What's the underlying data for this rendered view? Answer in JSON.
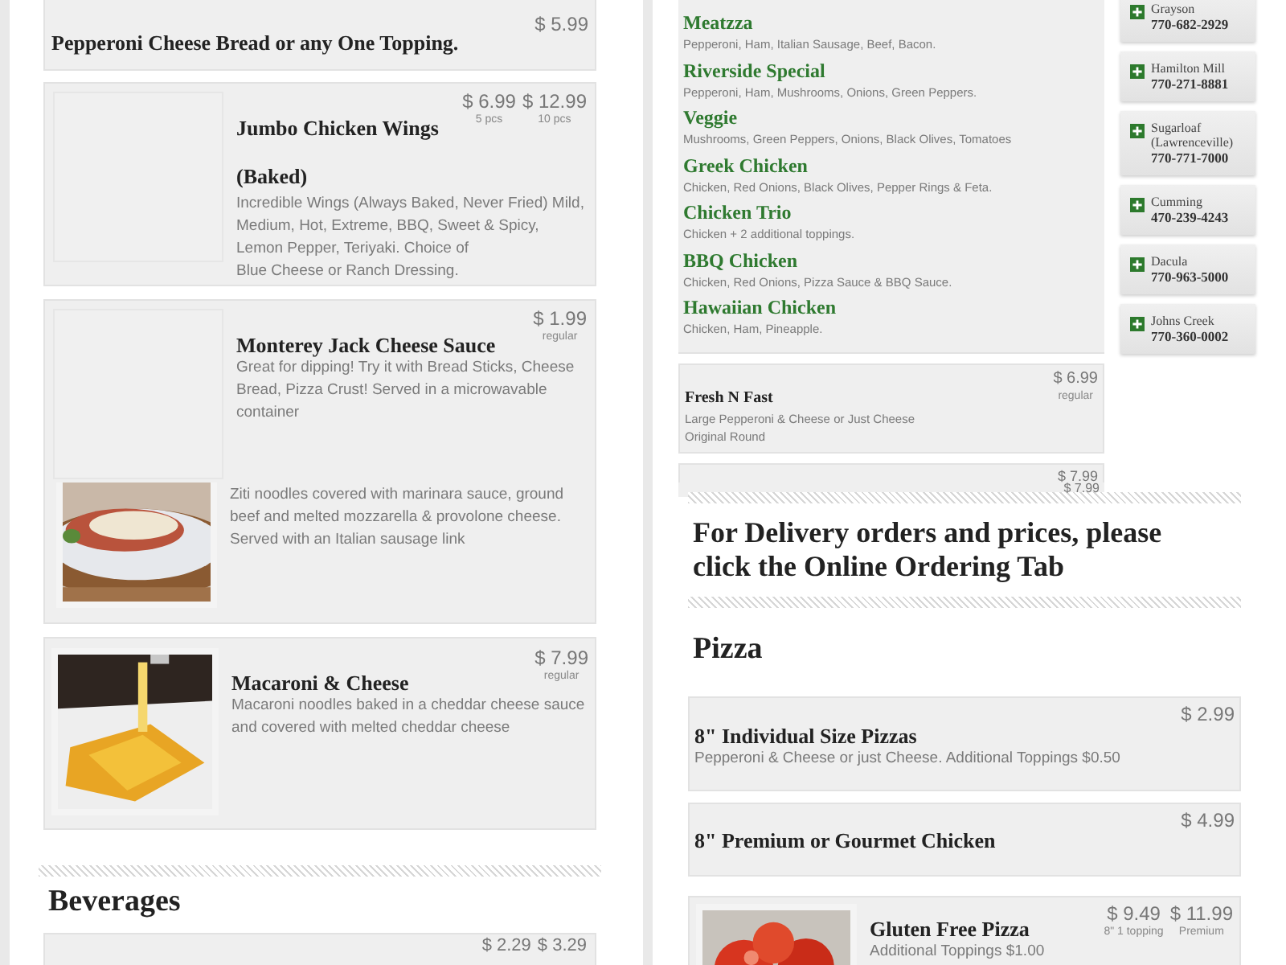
{
  "top_left": {
    "items": [
      {
        "title": "Pepperoni Cheese Bread or any One Topping.",
        "prices": [
          {
            "amount": "$ 5.99"
          }
        ]
      },
      {
        "title": "Jumbo Chicken Wings",
        "subtitle": "(Baked)",
        "prices": [
          {
            "amount": "$ 6.99",
            "note": "5 pcs"
          },
          {
            "amount": "$ 12.99",
            "note": "10 pcs"
          }
        ],
        "description": [
          "Incredible Wings (Always Baked, Never Fried) Mild, Medium, Hot, Extreme, BBQ, Sweet & Spicy, Lemon Pepper, Teriyaki. Choice of",
          "Blue Cheese or Ranch Dressing."
        ]
      },
      {
        "title": "Monterey Jack Cheese Sauce",
        "prices": [
          {
            "amount": "$ 1.99",
            "note": "regular"
          }
        ],
        "description": [
          "Great for dipping! Try it with Bread Sticks, Cheese Bread, Pizza Crust! Served in a microwavable container"
        ]
      }
    ]
  },
  "top_right": {
    "specialties": [
      {
        "name": "Meatzza",
        "toppings": "Pepperoni, Ham, Italian Sausage, Beef, Bacon."
      },
      {
        "name": "Riverside Special",
        "toppings": "Pepperoni, Ham, Mushrooms, Onions, Green Peppers."
      },
      {
        "name": "Veggie",
        "toppings": "Mushrooms, Green Peppers, Onions, Black Olives, Tomatoes"
      },
      {
        "name": "Greek Chicken",
        "toppings": "Chicken, Red Onions, Black Olives, Pepper Rings & Feta."
      },
      {
        "name": "Chicken Trio",
        "toppings": "Chicken + 2 additional toppings."
      },
      {
        "name": "BBQ Chicken",
        "toppings": "Chicken, Red Onions, Pizza Sauce & BBQ Sauce."
      },
      {
        "name": "Hawaiian Chicken",
        "toppings": "Chicken, Ham, Pineapple."
      }
    ],
    "items": [
      {
        "title": "Fresh N Fast",
        "prices": [
          {
            "amount": "$ 6.99",
            "note": "regular"
          }
        ],
        "description": [
          "Large Pepperoni & Cheese or Just Cheese",
          "Original Round"
        ]
      },
      {
        "prices": [
          {
            "amount": "$ 7.99"
          }
        ]
      }
    ],
    "locations": [
      {
        "name": "Grayson",
        "phone": "770-682-2929"
      },
      {
        "name": "Hamilton Mill",
        "phone": "770-271-8881"
      },
      {
        "name": "Sugarloaf (Lawrenceville)",
        "phone": "770-771-7000"
      },
      {
        "name": "Cumming",
        "phone": "470-239-4243"
      },
      {
        "name": "Dacula",
        "phone": "770-963-5000"
      },
      {
        "name": "Johns Creek",
        "phone": "770-360-0002"
      }
    ]
  },
  "bottom_left": {
    "items": [
      {
        "description": [
          "Ziti noodles covered with marinara sauce, ground beef and melted mozzarella & provolone cheese. Served with an Italian sausage link"
        ]
      },
      {
        "title": "Macaroni & Cheese",
        "prices": [
          {
            "amount": "$ 7.99",
            "note": "regular"
          }
        ],
        "description": [
          "Macaroni noodles baked in a cheddar cheese sauce and covered with melted cheddar cheese"
        ]
      }
    ],
    "section": "Beverages",
    "section_items": [
      {
        "prices": [
          {
            "amount": "$ 2.29"
          },
          {
            "amount": "$ 3.29"
          }
        ]
      }
    ]
  },
  "bottom_right": {
    "top_item": {
      "prices": [
        {
          "amount": "$ 7.99"
        }
      ]
    },
    "notice": "For Delivery orders and prices, please click the Online Ordering Tab",
    "section": "Pizza",
    "items": [
      {
        "title": "8\" Individual Size Pizzas",
        "prices": [
          {
            "amount": "$ 2.99"
          }
        ],
        "description": [
          "Pepperoni & Cheese or just Cheese. Additional Toppings $0.50"
        ]
      },
      {
        "title": "8\" Premium or Gourmet Chicken",
        "prices": [
          {
            "amount": "$ 4.99"
          }
        ]
      },
      {
        "title": "Gluten Free Pizza",
        "prices": [
          {
            "amount": "$ 9.49",
            "note": "8\" 1 topping"
          },
          {
            "amount": "$ 11.99",
            "note": "Premium"
          }
        ],
        "description": [
          "Additional Toppings $1.00"
        ]
      }
    ]
  }
}
